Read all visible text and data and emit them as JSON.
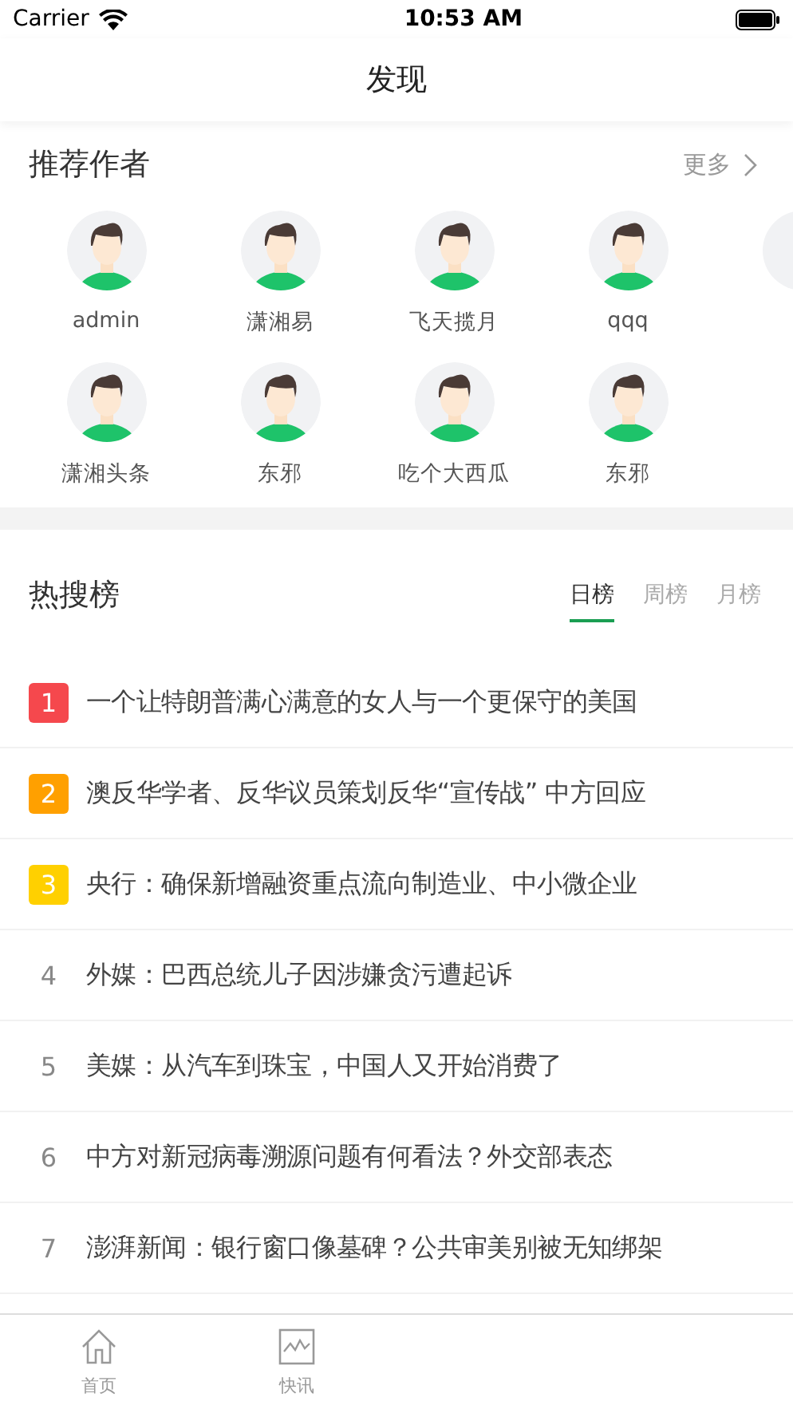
{
  "status_bar": {
    "carrier": "Carrier",
    "time": "10:53 AM"
  },
  "nav": {
    "title": "发现"
  },
  "authors": {
    "title": "推荐作者",
    "more": "更多",
    "rows": [
      [
        {
          "name": "admin"
        },
        {
          "name": "潇湘易"
        },
        {
          "name": "飞天揽月"
        },
        {
          "name": "qqq"
        },
        {
          "kind": "picture"
        }
      ],
      [
        {
          "name": "潇湘头条"
        },
        {
          "name": "东邪"
        },
        {
          "name": "吃个大西瓜"
        },
        {
          "name": "东邪"
        }
      ]
    ]
  },
  "hot": {
    "title": "热搜榜",
    "tabs": [
      {
        "label": "日榜",
        "selected": true
      },
      {
        "label": "周榜",
        "selected": false
      },
      {
        "label": "月榜",
        "selected": false
      }
    ],
    "items": [
      {
        "rank": "1",
        "kind": "badge",
        "color": "#f5484d",
        "title": "一个让特朗普满心满意的女人与一个更保守的美国"
      },
      {
        "rank": "2",
        "kind": "badge",
        "color": "#ffa000",
        "title": "澳反华学者、反华议员策划反华“宣传战” 中方回应"
      },
      {
        "rank": "3",
        "kind": "badge",
        "color": "#ffd000",
        "title": "央行：确保新增融资重点流向制造业、中小微企业"
      },
      {
        "rank": "4",
        "kind": "plain",
        "title": "外媒：巴西总统儿子因涉嫌贪污遭起诉"
      },
      {
        "rank": "5",
        "kind": "plain",
        "title": "美媒：从汽车到珠宝，中国人又开始消费了"
      },
      {
        "rank": "6",
        "kind": "plain",
        "title": "中方对新冠病毒溯源问题有何看法？外交部表态"
      },
      {
        "rank": "7",
        "kind": "plain",
        "title": "澎湃新闻：银行窗口像墓碑？公共审美别被无知绑架"
      }
    ]
  },
  "tab_bar": [
    {
      "label": "首页",
      "kind": "home"
    },
    {
      "label": "快讯",
      "kind": "chart"
    }
  ]
}
